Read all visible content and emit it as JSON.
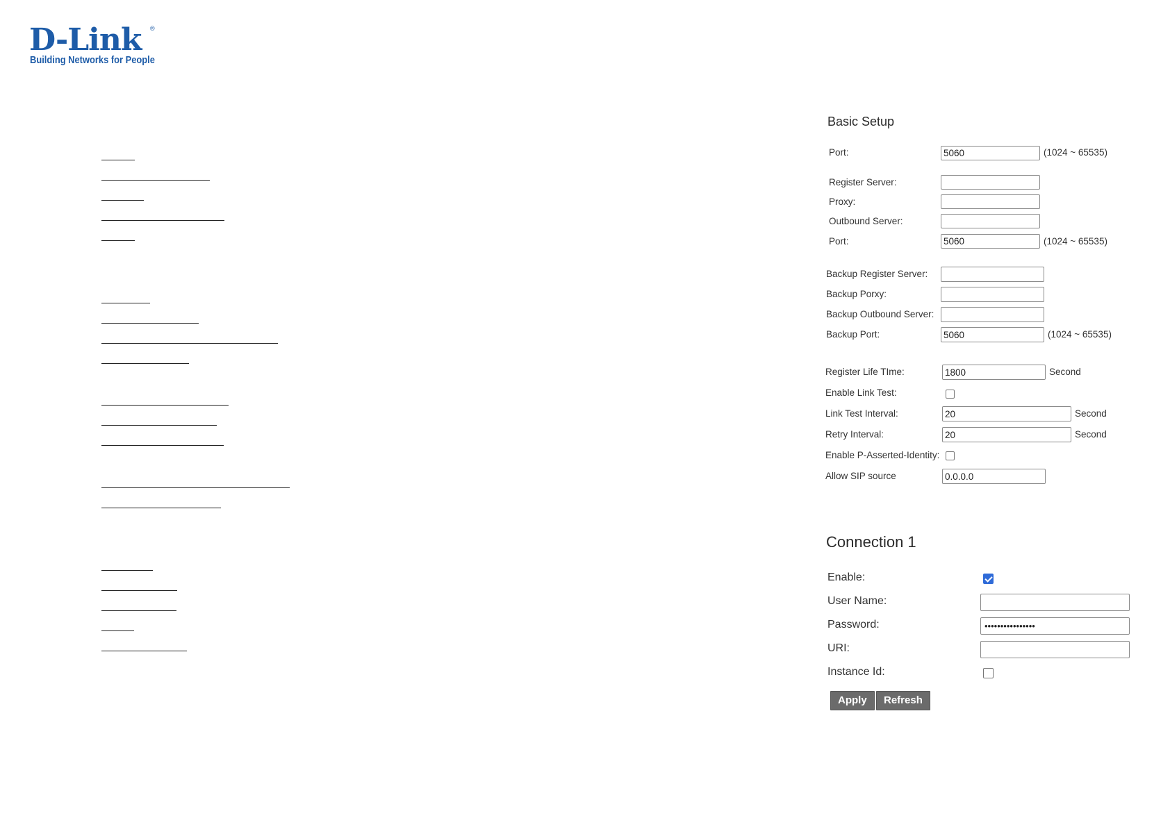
{
  "brand": {
    "name": "D-Link",
    "registered_mark": "®",
    "tagline": "Building Networks for People",
    "color": "#1e5ca8"
  },
  "basic_setup": {
    "title": "Basic Setup",
    "port_label": "Port:",
    "port_value": "5060",
    "port_range": "(1024 ~ 65535)",
    "register_server_label": "Register Server:",
    "register_server_value": "",
    "proxy_label": "Proxy:",
    "proxy_value": "",
    "outbound_server_label": "Outbound Server:",
    "outbound_server_value": "",
    "outbound_port_label": "Port:",
    "outbound_port_value": "5060",
    "outbound_port_range": "(1024 ~ 65535)",
    "backup_register_server_label": "Backup Register Server:",
    "backup_register_server_value": "",
    "backup_proxy_label": "Backup Porxy:",
    "backup_proxy_value": "",
    "backup_outbound_server_label": "Backup Outbound Server:",
    "backup_outbound_server_value": "",
    "backup_port_label": "Backup Port:",
    "backup_port_value": "5060",
    "backup_port_range": "(1024 ~ 65535)",
    "register_life_time_label": "Register Life TIme:",
    "register_life_time_value": "1800",
    "register_life_time_unit": "Second",
    "enable_link_test_label": "Enable Link Test:",
    "enable_link_test_checked": false,
    "link_test_interval_label": "Link Test Interval:",
    "link_test_interval_value": "20",
    "link_test_interval_unit": "Second",
    "retry_interval_label": "Retry Interval:",
    "retry_interval_value": "20",
    "retry_interval_unit": "Second",
    "enable_p_asserted_identity_label": "Enable P-Asserted-Identity:",
    "enable_p_asserted_identity_checked": false,
    "allow_sip_source_label": "Allow SIP source",
    "allow_sip_source_value": "0.0.0.0"
  },
  "connection": {
    "title": "Connection 1",
    "enable_label": "Enable:",
    "enable_checked": true,
    "user_name_label": "User Name:",
    "user_name_value": "",
    "password_label": "Password:",
    "password_value": "••••••••••••••••",
    "uri_label": "URI:",
    "uri_value": "",
    "instance_id_label": "Instance Id:",
    "instance_id_checked": false
  },
  "actions": {
    "apply_label": "Apply",
    "refresh_label": "Refresh",
    "button_color": "#6b6b6b"
  },
  "colors": {
    "checkbox_checked": "#2f6bd8"
  }
}
